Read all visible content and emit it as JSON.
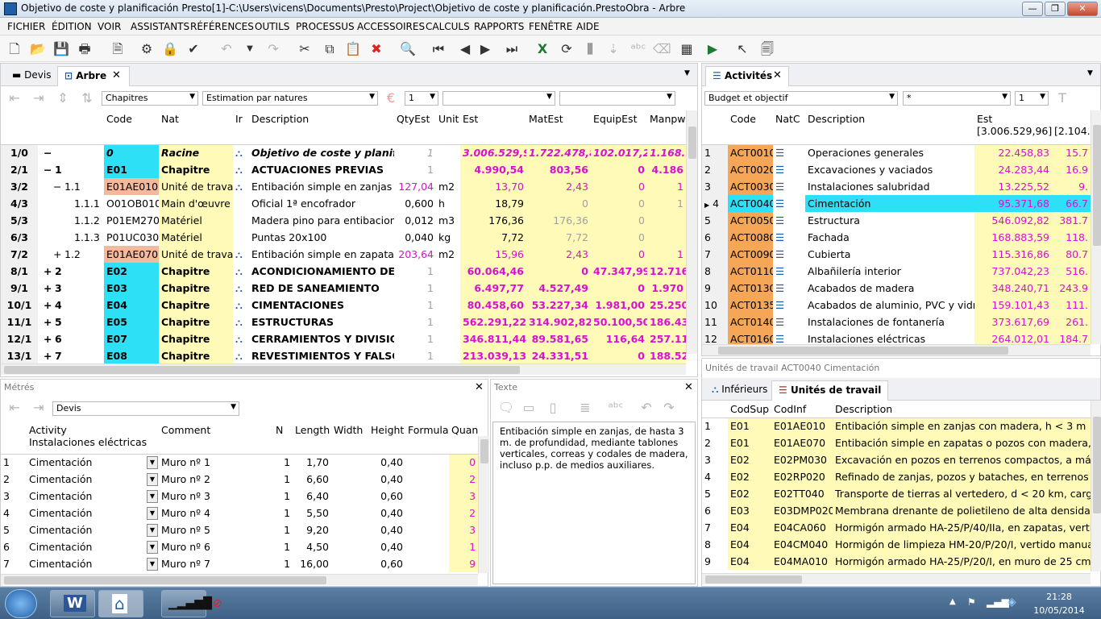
{
  "window": {
    "title": "Objetivo de coste y planificación Presto[1]-C:\\Users\\vicens\\Documents\\Presto\\Project\\Objetivo de coste y planificación.PrestoObra - Arbre"
  },
  "menu": [
    "FICHIER",
    "ÉDITION",
    "VOIR",
    "ASSISTANTS",
    "RÉFÉRENCES",
    "OUTILS",
    "PROCESSUS",
    "ACCESSOIRES",
    "CALCULS",
    "RAPPORTS",
    "FENÊTRE",
    "AIDE"
  ],
  "tree": {
    "tabs": [
      "Devis",
      "Arbre"
    ],
    "filter1": "Chapitres",
    "filter2": "Estimation par natures",
    "level": "1",
    "columns": [
      "Code",
      "Nat",
      "Ir",
      "Description",
      "QtyEst",
      "Unit",
      "Est",
      "MatEst",
      "EquipEst",
      "Manpw"
    ],
    "rows": [
      {
        "n": "1/0",
        "sign": "−",
        "num": "",
        "code": "0",
        "nat": "Racine",
        "desc": "Objetivo de coste y planifica",
        "qty": "1",
        "unit": "",
        "est": "3.006.529,96",
        "mat": "1.722.478,84",
        "equip": "102.017,21",
        "man": "1.168.99"
      },
      {
        "n": "2/1",
        "sign": "−",
        "num": "1",
        "code": "E01",
        "nat": "Chapitre",
        "desc": "ACTUACIONES PREVIAS",
        "qty": "1",
        "unit": "",
        "est": "4.990,54",
        "mat": "803,56",
        "equip": "0",
        "man": "4.186"
      },
      {
        "n": "3/2",
        "sign": "−",
        "num": "1.1",
        "code": "E01AE010",
        "nat": "Unité de travail",
        "desc": "Entibación simple en zanjas co",
        "qty": "127,04",
        "unit": "m2",
        "est": "13,70",
        "mat": "2,43",
        "equip": "0",
        "man": "1"
      },
      {
        "n": "4/3",
        "sign": "",
        "num": "1.1.1",
        "code": "O01OB010",
        "nat": "Main d'œuvre",
        "desc": "Oficial 1ª encofrador",
        "qty": "0,600",
        "unit": "h",
        "est": "18,79",
        "mat": "0",
        "equip": "0",
        "man": "1"
      },
      {
        "n": "5/3",
        "sign": "",
        "num": "1.1.2",
        "code": "P01EM270",
        "nat": "Matériel",
        "desc": "Madera pino para entibacione",
        "qty": "0,012",
        "unit": "m3",
        "est": "176,36",
        "mat": "176,36",
        "equip": "0",
        "man": ""
      },
      {
        "n": "6/3",
        "sign": "",
        "num": "1.1.3",
        "code": "P01UC030",
        "nat": "Matériel",
        "desc": "Puntas 20x100",
        "qty": "0,040",
        "unit": "kg",
        "est": "7,72",
        "mat": "7,72",
        "equip": "0",
        "man": ""
      },
      {
        "n": "7/2",
        "sign": "+",
        "num": "1.2",
        "code": "E01AE070",
        "nat": "Unité de travail",
        "desc": "Entibación simple en zapatas",
        "qty": "203,64",
        "unit": "m2",
        "est": "15,96",
        "mat": "2,43",
        "equip": "0",
        "man": "1"
      },
      {
        "n": "8/1",
        "sign": "+",
        "num": "2",
        "code": "E02",
        "nat": "Chapitre",
        "desc": "ACONDICIONAMIENTO DEL",
        "qty": "1",
        "unit": "",
        "est": "60.064,46",
        "mat": "0",
        "equip": "47.347,99",
        "man": "12.716"
      },
      {
        "n": "9/1",
        "sign": "+",
        "num": "3",
        "code": "E03",
        "nat": "Chapitre",
        "desc": "RED DE SANEAMIENTO",
        "qty": "1",
        "unit": "",
        "est": "6.497,77",
        "mat": "4.527,49",
        "equip": "0",
        "man": "1.970"
      },
      {
        "n": "10/1",
        "sign": "+",
        "num": "4",
        "code": "E04",
        "nat": "Chapitre",
        "desc": "CIMENTACIONES",
        "qty": "1",
        "unit": "",
        "est": "80.458,60",
        "mat": "53.227,34",
        "equip": "1.981,00",
        "man": "25.250"
      },
      {
        "n": "11/1",
        "sign": "+",
        "num": "5",
        "code": "E05",
        "nat": "Chapitre",
        "desc": "ESTRUCTURAS",
        "qty": "1",
        "unit": "",
        "est": "562.291,22",
        "mat": "314.902,82",
        "equip": "50.100,50",
        "man": "186.438"
      },
      {
        "n": "12/1",
        "sign": "+",
        "num": "6",
        "code": "E07",
        "nat": "Chapitre",
        "desc": "CERRAMIENTOS Y DIVISIONI",
        "qty": "1",
        "unit": "",
        "est": "346.811,44",
        "mat": "89.581,65",
        "equip": "116,64",
        "man": "257.113"
      },
      {
        "n": "13/1",
        "sign": "+",
        "num": "7",
        "code": "E08",
        "nat": "Chapitre",
        "desc": "REVESTIMIENTOS Y FALSOS",
        "qty": "1",
        "unit": "",
        "est": "213.039,13",
        "mat": "24.331,51",
        "equip": "0",
        "man": "188.527"
      }
    ]
  },
  "activities": {
    "tab": "Activités",
    "filter1": "Budget et objectif",
    "filter2": "*",
    "level": "1",
    "columns": [
      "Code",
      "NatC",
      "Description",
      "Est"
    ],
    "est_total": "[3.006.529,96]",
    "est_total2": "[2.104.3",
    "rows": [
      {
        "n": "1",
        "code": "ACT0010",
        "desc": "Operaciones generales",
        "est": "22.458,83",
        "e2": "15.7"
      },
      {
        "n": "2",
        "code": "ACT0020",
        "desc": "Excavaciones y vaciados",
        "est": "24.283,44",
        "e2": "16.9"
      },
      {
        "n": "3",
        "code": "ACT0030",
        "desc": "Instalaciones salubridad",
        "est": "13.225,52",
        "e2": "9."
      },
      {
        "n": "4",
        "code": "ACT0040",
        "desc": "Cimentación",
        "est": "95.371,68",
        "e2": "66.7"
      },
      {
        "n": "5",
        "code": "ACT0050",
        "desc": "Estructura",
        "est": "546.092,82",
        "e2": "381.7"
      },
      {
        "n": "6",
        "code": "ACT0080",
        "desc": "Fachada",
        "est": "168.883,59",
        "e2": "118."
      },
      {
        "n": "7",
        "code": "ACT0090",
        "desc": "Cubierta",
        "est": "115.316,86",
        "e2": "80.7"
      },
      {
        "n": "8",
        "code": "ACT0110",
        "desc": "Albañilería interior",
        "est": "737.042,23",
        "e2": "516."
      },
      {
        "n": "9",
        "code": "ACT0130",
        "desc": "Acabados de madera",
        "est": "348.240,71",
        "e2": "243.9"
      },
      {
        "n": "10",
        "code": "ACT0135",
        "desc": "Acabados de aluminio, PVC y vidrio",
        "est": "159.101,43",
        "e2": "111."
      },
      {
        "n": "11",
        "code": "ACT0140",
        "desc": "Instalaciones de fontanería",
        "est": "373.617,69",
        "e2": "261."
      },
      {
        "n": "12",
        "code": "ACT0160",
        "desc": "Instalaciones eléctricas",
        "est": "264.012,01",
        "e2": "184.7"
      }
    ]
  },
  "metres": {
    "title": "Métrés",
    "filter": "Devis",
    "col_activity": "Activity",
    "col_activity_sub": "Instalaciones eléctricas",
    "col_comment": "Comment",
    "col_n": "N",
    "col_length": "Length",
    "col_width": "Width",
    "col_height": "Height",
    "col_formula": "Formula",
    "col_qty": "Quan",
    "rows": [
      {
        "n": "1",
        "act": "Cimentación",
        "comment": "Muro nº 1",
        "N": "1",
        "len": "1,70",
        "h": "0,40",
        "q": "0"
      },
      {
        "n": "2",
        "act": "Cimentación",
        "comment": "Muro nº 2",
        "N": "1",
        "len": "6,60",
        "h": "0,40",
        "q": "2"
      },
      {
        "n": "3",
        "act": "Cimentación",
        "comment": "Muro nº 3",
        "N": "1",
        "len": "6,40",
        "h": "0,60",
        "q": "3"
      },
      {
        "n": "4",
        "act": "Cimentación",
        "comment": "Muro nº 4",
        "N": "1",
        "len": "5,50",
        "h": "0,40",
        "q": "2"
      },
      {
        "n": "5",
        "act": "Cimentación",
        "comment": "Muro nº 5",
        "N": "1",
        "len": "9,20",
        "h": "0,40",
        "q": "3"
      },
      {
        "n": "6",
        "act": "Cimentación",
        "comment": "Muro nº 6",
        "N": "1",
        "len": "4,50",
        "h": "0,40",
        "q": "1"
      },
      {
        "n": "7",
        "act": "Cimentación",
        "comment": "Muro nº 7",
        "N": "1",
        "len": "16,00",
        "h": "0,60",
        "q": "9"
      }
    ]
  },
  "texte": {
    "title": "Texte",
    "body": "Entibación simple en zanjas, de hasta 3 m. de profundidad, mediante tablones verticales, correas y codales de madera, incluso p.p. de medios auxiliares."
  },
  "units": {
    "title": "Unités de travail ACT0040 Cimentación",
    "tabs": [
      "Inférieurs",
      "Unités de travail"
    ],
    "columns": [
      "CodSup",
      "CodInf",
      "Description"
    ],
    "rows": [
      {
        "n": "1",
        "sup": "E01",
        "inf": "E01AE010",
        "desc": "Entibación simple en zanjas con madera, h < 3 m"
      },
      {
        "n": "2",
        "sup": "E01",
        "inf": "E01AE070",
        "desc": "Entibación simple en zapatas o pozos con madera, h"
      },
      {
        "n": "3",
        "sup": "E02",
        "inf": "E02PM030",
        "desc": "Excavación en pozos en terrenos compactos, a máqui"
      },
      {
        "n": "4",
        "sup": "E02",
        "inf": "E02RP020",
        "desc": "Refinado de zanjas, pozos y bataches, en terrenos du"
      },
      {
        "n": "5",
        "sup": "E02",
        "inf": "E02TT040",
        "desc": "Transporte de tierras al vertedero, d < 20 km, carga a"
      },
      {
        "n": "6",
        "sup": "E03",
        "inf": "E03DMP020",
        "desc": "Membrana drenante de polietileno de alta densidad h"
      },
      {
        "n": "7",
        "sup": "E04",
        "inf": "E04CA060",
        "desc": "Hormigón armado HA-25/P/40/IIa, en zapatas, vertido"
      },
      {
        "n": "8",
        "sup": "E04",
        "inf": "E04CM040",
        "desc": "Hormigón de limpieza HM-20/P/20/I, vertido manual"
      },
      {
        "n": "9",
        "sup": "E04",
        "inf": "E04MA010",
        "desc": "Hormigón armado HA-25/P/20/I, en muro de 25 cm, 1"
      }
    ]
  },
  "taskbar": {
    "time": "21:28",
    "date": "10/05/2014"
  }
}
